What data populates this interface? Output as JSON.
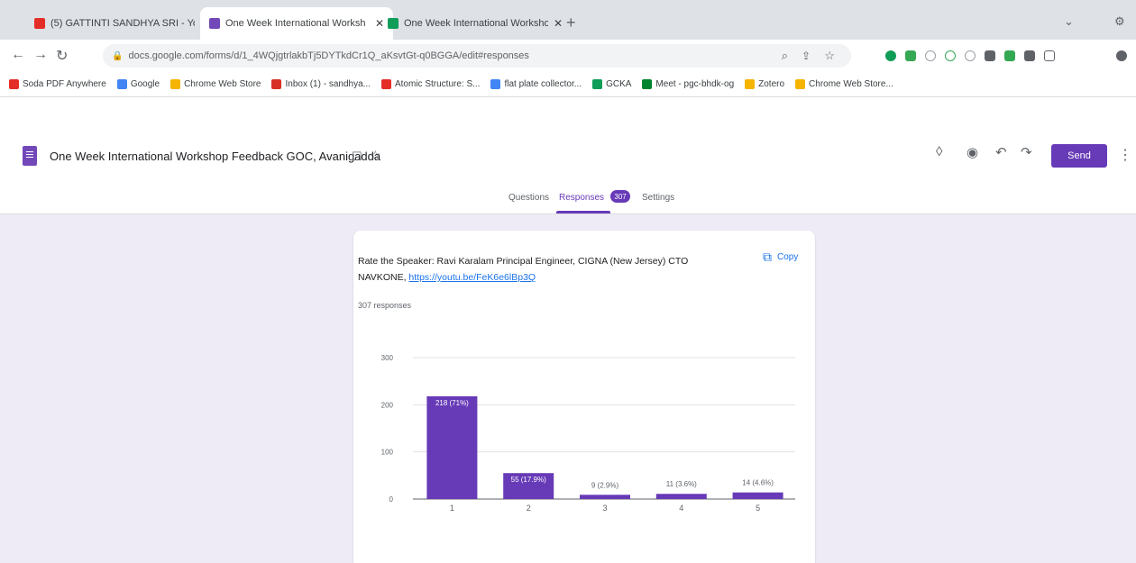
{
  "browser": {
    "tabs": [
      {
        "title": "(5) GATTINTI SANDHYA SRI - Yo",
        "icon_color": "#e52d27",
        "active": false
      },
      {
        "title": "One Week International Worksh",
        "icon_color": "#7248b9",
        "active": true
      },
      {
        "title": "One Week International Worksho",
        "icon_color": "#0f9d58",
        "active": false
      }
    ],
    "new_tab": "+",
    "url": "docs.google.com/forms/d/1_4WQjgtrlakbTj5DYTkdCr1Q_aKsvtGt-q0BGGA/edit#responses",
    "bookmarks": [
      {
        "label": "Soda PDF Anywhere",
        "color": "#e52d27"
      },
      {
        "label": "Google",
        "color": "#4285f4"
      },
      {
        "label": "Chrome Web Store",
        "color": "#f4b400"
      },
      {
        "label": "Inbox (1) - sandhya...",
        "color": "#d93025"
      },
      {
        "label": "Atomic Structure: S...",
        "color": "#e52d27"
      },
      {
        "label": "flat plate collector...",
        "color": "#4285f4"
      },
      {
        "label": "GCKA",
        "color": "#0f9d58"
      },
      {
        "label": "Meet - pgc-bhdk-og",
        "color": "#00832d"
      },
      {
        "label": "Zotero",
        "color": "#f4b400"
      },
      {
        "label": "Chrome Web Store...",
        "color": "#f4b400"
      }
    ]
  },
  "form": {
    "title": "One Week International Workshop Feedback GOC, Avanigadda",
    "send_label": "Send",
    "tabs": [
      "Questions",
      "Responses",
      "Settings"
    ],
    "responses_badge": "307",
    "accent": "#673ab7"
  },
  "question": {
    "title_text": "Rate the Speaker: Ravi Karalam Principal Engineer, CIGNA (New Jersey) CTO NAVKONE, ",
    "link": "https://youtu.be/FeK6e6lBp3Q",
    "copy_label": "Copy",
    "responses_text": "307 responses"
  },
  "chart_data": {
    "type": "bar",
    "categories": [
      "1",
      "2",
      "3",
      "4",
      "5"
    ],
    "values": [
      218,
      55,
      9,
      11,
      14
    ],
    "data_labels": [
      "218 (71%)",
      "55 (17.9%)",
      "9 (2.9%)",
      "11 (3.6%)",
      "14 (4.6%)"
    ],
    "yticks": [
      0,
      100,
      200,
      300
    ],
    "ylim": [
      0,
      300
    ],
    "bar_color": "#673ab7",
    "grid": true
  }
}
